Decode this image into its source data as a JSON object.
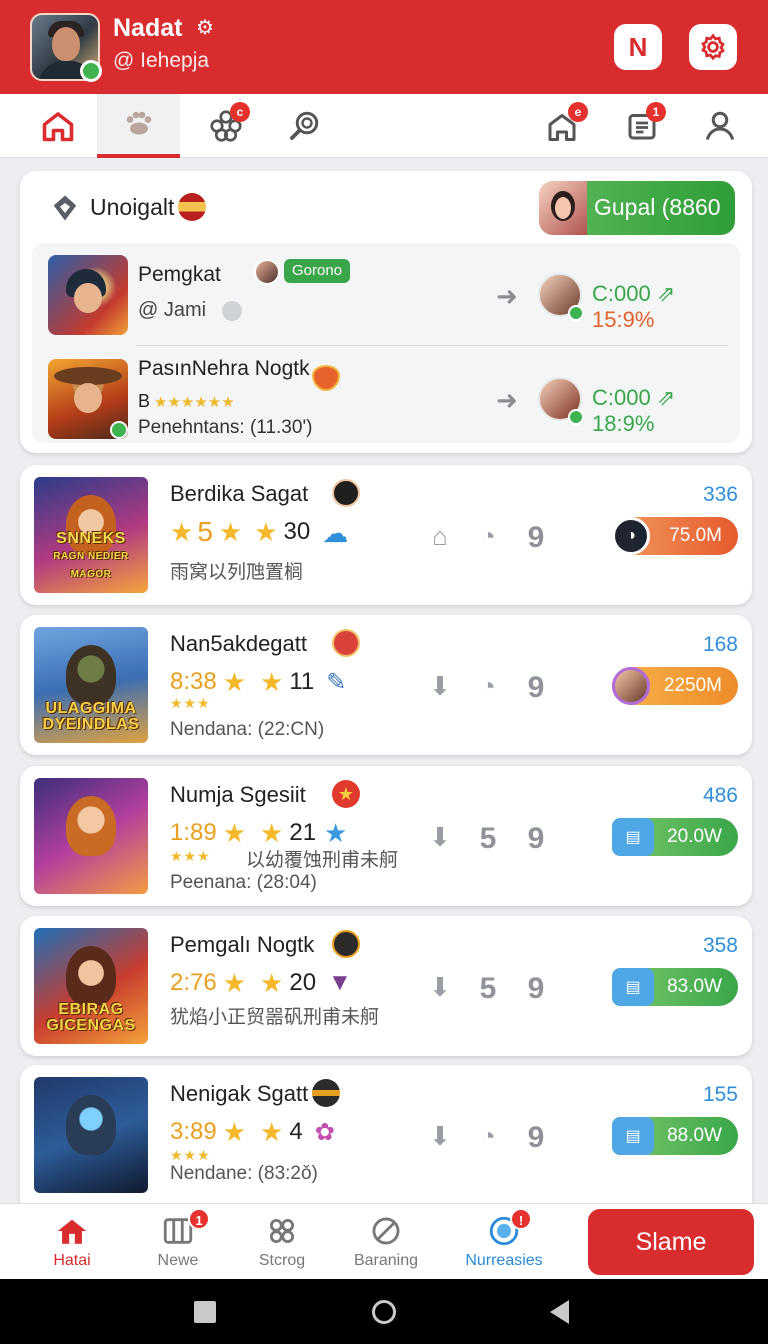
{
  "header": {
    "name": "Nadat",
    "handle": "@ Iehepja",
    "n_button": "N",
    "colors": {
      "brand": "#d92c2f",
      "green": "#3aa64a",
      "blue": "#2f8fd8",
      "orange": "#e9a020"
    }
  },
  "tabs": [
    {
      "icon": "home-icon",
      "badge": ""
    },
    {
      "icon": "paw-icon",
      "badge": ""
    },
    {
      "icon": "flower-icon",
      "badge": ""
    },
    {
      "icon": "search-icon",
      "badge": ""
    },
    {
      "icon": "notification-house-icon",
      "badge": ""
    },
    {
      "icon": "calendar-icon",
      "badge": "1"
    },
    {
      "icon": "profile-icon",
      "badge": ""
    }
  ],
  "featured": {
    "title": "Unoigalt",
    "pill_label": "Gupal (8860",
    "rows": [
      {
        "title": "Pemgkat",
        "tag": "Gorono",
        "sub": "@ Jami",
        "score_a": "C:000",
        "score_b": "15:9%"
      },
      {
        "title": "PasınNehra Nogtk",
        "rank": "B",
        "stars": "★★★★★★",
        "sub": "Penehntans: (11.30')",
        "score_a": "C:000",
        "score_b": "18:9%"
      }
    ]
  },
  "games": [
    {
      "title": "Berdika Sagat",
      "count": "336",
      "rating": "5",
      "reviews": "30",
      "line": "雨窝以列虺置榈",
      "pill": "75.0M",
      "thumb_label": "SNNEKS\nRAGN NEDIER MAGOR",
      "icons": [
        "⌂",
        "◔",
        "9"
      ]
    },
    {
      "title": "Nan5akdegatt",
      "count": "168",
      "rating": "8:38",
      "reviews": "11",
      "stars": "★★★",
      "line": "Nendana: (22:CN)",
      "pill": "2250M",
      "thumb_label": "ULAGGIMA\nDYEINDLAS",
      "icons": [
        "⬇",
        "◔",
        "9"
      ]
    },
    {
      "title": "Numja Sgesiit",
      "count": "486",
      "rating": "1:89",
      "reviews": "21",
      "stars": "★★★",
      "line_cjk": "以幼覆蚀刑甫未舸",
      "line": "Peenana: (28:04)",
      "pill": "20.0W",
      "thumb_label": "",
      "icons": [
        "⬇",
        "5",
        "9"
      ]
    },
    {
      "title": "Pemgalı Nogtk",
      "count": "358",
      "rating": "2:76",
      "reviews": "20",
      "line": "犹焰小正贸噐矾刑甫未舸",
      "pill": "83.0W",
      "thumb_label": "EBIRAG\nGICENGAS",
      "icons": [
        "⬇",
        "5",
        "9"
      ]
    },
    {
      "title": "Nenigak Sgatt",
      "count": "155",
      "rating": "3:89",
      "reviews": "4",
      "stars": "★★★",
      "line": "Nendane: (83:2ǒ)",
      "pill": "88.0W",
      "thumb_label": "",
      "icons": [
        "⬇",
        "◔",
        "9"
      ]
    }
  ],
  "bottom_nav": [
    {
      "label": "Hatai",
      "badge": ""
    },
    {
      "label": "Newe",
      "badge": "1"
    },
    {
      "label": "Stcrog",
      "badge": ""
    },
    {
      "label": "Baraning",
      "badge": ""
    },
    {
      "label": "Nurreasies",
      "badge": ""
    }
  ],
  "primary_button": "Slame"
}
